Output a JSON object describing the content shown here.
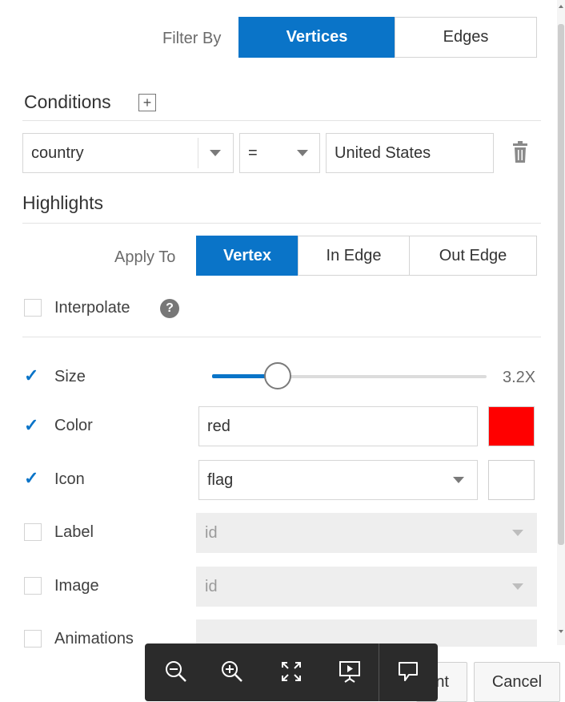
{
  "filter_by": {
    "label": "Filter By",
    "options": [
      "Vertices",
      "Edges"
    ],
    "selected": "Vertices"
  },
  "conditions": {
    "title": "Conditions",
    "property": "country",
    "operator": "=",
    "value": "United States"
  },
  "highlights": {
    "title": "Highlights",
    "apply_to": {
      "label": "Apply To",
      "options": [
        "Vertex",
        "In Edge",
        "Out Edge"
      ],
      "selected": "Vertex"
    },
    "interpolate": {
      "label": "Interpolate",
      "checked": false
    },
    "size": {
      "label": "Size",
      "checked": true,
      "value_text": "3.2X",
      "slider_fraction": 0.28
    },
    "color": {
      "label": "Color",
      "checked": true,
      "value": "red",
      "swatch": "#ff0000"
    },
    "icon": {
      "label": "Icon",
      "checked": true,
      "value": "flag",
      "swatch": "#ffffff"
    },
    "label": {
      "label": "Label",
      "checked": false,
      "value": "id"
    },
    "image": {
      "label": "Image",
      "checked": false,
      "value": "id"
    },
    "animations": {
      "label": "Animations",
      "checked": false
    }
  },
  "footer": {
    "apply_partial": "nt",
    "cancel": "Cancel"
  },
  "toolbar": {
    "icons": [
      "zoom-out-icon",
      "zoom-in-icon",
      "fit-icon",
      "present-icon",
      "comment-icon"
    ]
  },
  "colors": {
    "accent": "#0a74c8",
    "toolbar_bg": "#2b2b2b"
  }
}
